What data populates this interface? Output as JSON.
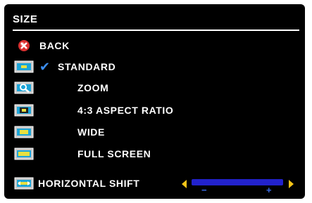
{
  "menu": {
    "title": "SIZE",
    "items": [
      {
        "label": "BACK",
        "icon": "back-icon"
      },
      {
        "label": "STANDARD",
        "icon": "standard-screen-icon",
        "selected": true
      },
      {
        "label": "ZOOM",
        "icon": "zoom-icon"
      },
      {
        "label": "4:3 ASPECT RATIO",
        "icon": "aspect-ratio-icon"
      },
      {
        "label": "WIDE",
        "icon": "wide-screen-icon"
      },
      {
        "label": "FULL SCREEN",
        "icon": "full-screen-icon"
      },
      {
        "label": "HORIZONTAL SHIFT",
        "icon": "horizontal-shift-icon"
      }
    ]
  },
  "slider": {
    "minus_label": "−",
    "plus_label": "+",
    "value_fraction": 1.0
  },
  "colors": {
    "background": "#000000",
    "text": "#ffffff",
    "check": "#3b8df0",
    "slider_track": "#2222cc",
    "slider_arrows": "#f5c518"
  }
}
